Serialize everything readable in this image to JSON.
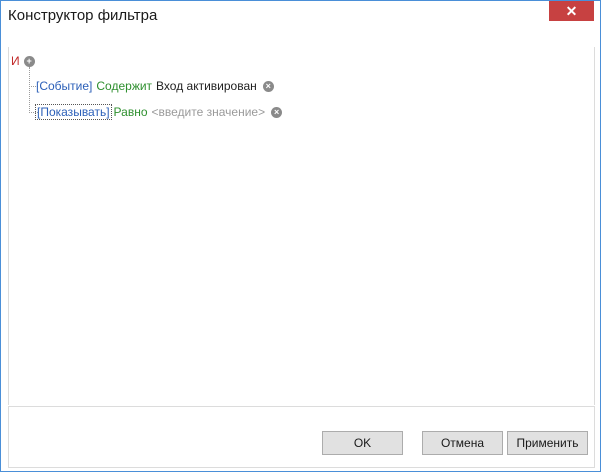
{
  "window": {
    "title": "Конструктор фильтра",
    "close_label": "✕"
  },
  "filter": {
    "group_operator": "И",
    "conditions": [
      {
        "field": "[Событие]",
        "operator": "Содержит",
        "value": "Вход активирован",
        "is_placeholder": false
      },
      {
        "field": "[Показывать]",
        "operator": "Равно",
        "value": "<введите значение>",
        "is_placeholder": true
      }
    ]
  },
  "footer": {
    "ok_label": "OK",
    "cancel_label": "Отмена",
    "apply_label": "Применить"
  },
  "colors": {
    "group_operator": "#c22a2a",
    "field": "#2b5fb8",
    "operator": "#2e8f2e",
    "placeholder": "#9a9a9a",
    "close_button": "#c74141",
    "window_border": "#4a8fd8"
  },
  "icons": {
    "add_condition": "plus-circle-icon",
    "remove_condition": "x-circle-icon"
  }
}
